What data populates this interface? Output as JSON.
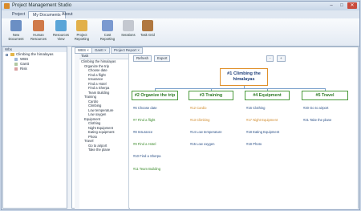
{
  "app": {
    "title": "Project Management Studio"
  },
  "window": {
    "min": "–",
    "max": "□",
    "close": "✕"
  },
  "tabs": [
    "Project",
    "My Documents",
    "About"
  ],
  "ribbon": [
    {
      "label": "New Document",
      "icon": "new-document-icon",
      "color": "#6b8fc4"
    },
    {
      "label": "Human Resources",
      "icon": "human-resources-icon",
      "color": "#d07a4a"
    },
    {
      "label": "Resources View",
      "icon": "resources-view-icon",
      "color": "#5aa5d8"
    },
    {
      "label": "Project Reporting",
      "icon": "project-reporting-icon",
      "color": "#e2b04a"
    },
    {
      "label": "Cost Reporting",
      "icon": "cost-reporting-icon",
      "color": "#7b9ad0"
    },
    {
      "label": "Iterations",
      "icon": "iterations-icon",
      "color": "#c4c8d0"
    },
    {
      "label": "Task Grid",
      "icon": "task-grid-icon",
      "color": "#b07840"
    }
  ],
  "sidebar": {
    "title": "Wbs",
    "root": "Climbing the himalayas",
    "items": [
      "WBS",
      "Gantt",
      "Risk"
    ]
  },
  "doc_tabs": [
    "WBS",
    "Gantt",
    "Project Report"
  ],
  "doc_tab_close": "×",
  "toolbar": {
    "refresh": "Refresh",
    "export": "Export",
    "minus": "-",
    "plus": "+"
  },
  "task": {
    "header": "Task",
    "rows": [
      "Climbing the himalayas",
      "Organize the trip",
      "Choose date",
      "Find a flight",
      "Insurance",
      "Find a Hotel",
      "Find a Sherpa",
      "Team Building",
      "Training",
      "Cardio",
      "Climbing",
      "Low temperature",
      "Low oxygen",
      "Equipment",
      "Clothing",
      "Night Equipment",
      "Eating equipment",
      "Photo",
      "Travel",
      "Go to airport",
      "Take the plane"
    ]
  },
  "wbs": {
    "root": "#1 Climbing the himalayas",
    "branches": [
      {
        "label": "#2 Organize the trip",
        "leaves": [
          "#6 Choose date",
          "#7 Find a flight",
          "#8 Insurance",
          "#9 Find a Hotel",
          "#10 Find a Sherpa",
          "#11 Team Building"
        ]
      },
      {
        "label": "#3 Training",
        "leaves": [
          "#12 Cardio",
          "#13 Climbing",
          "#14 Low temperature",
          "#15 Low oxygen"
        ]
      },
      {
        "label": "#4 Equipment",
        "leaves": [
          "#16 Clothing",
          "#17 Night Equipment",
          "#18 Eating Equipment",
          "#19 Photo"
        ]
      },
      {
        "label": "#5 Travel",
        "leaves": [
          "#20 Go to airport",
          "#21 Take the plane"
        ]
      }
    ]
  }
}
